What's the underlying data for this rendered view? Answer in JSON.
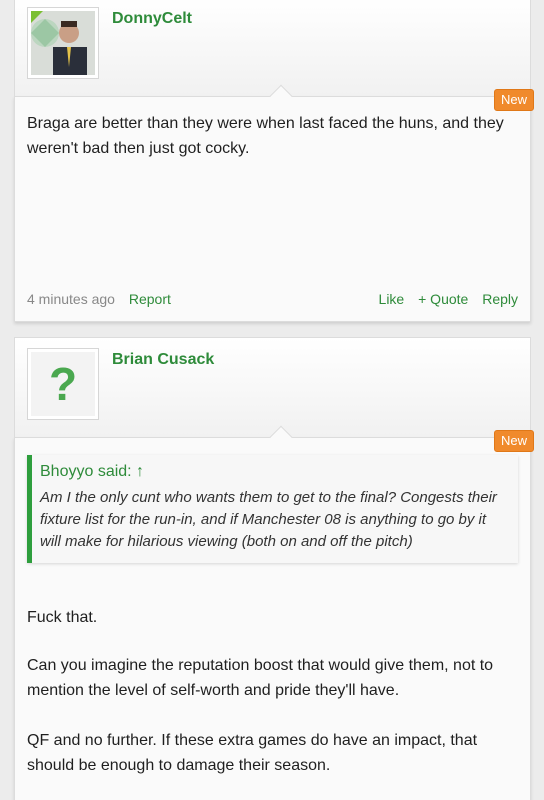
{
  "posts": [
    {
      "username": "DonnyCelt",
      "badge": "New",
      "message": "Braga are better than they were when last faced the huns, and they weren't bad then just got cocky.",
      "time": "4 minutes ago",
      "report": "Report",
      "like": "Like",
      "quote": "+ Quote",
      "reply": "Reply"
    },
    {
      "username": "Brian Cusack",
      "avatar_glyph": "?",
      "badge": "New",
      "quote_author": "Bhoyyo said: ↑",
      "quote_text": "Am I the only cunt who wants them to get to the final? Congests their fixture list for the run-in, and if Manchester 08 is anything to go by it will make for hilarious viewing (both on and off the pitch)",
      "paragraphs": [
        "Fuck that.",
        "Can you imagine the reputation boost that would give them, not to mention the level of self-worth and pride they'll have.",
        "QF and no further. If these extra games do have an impact, that should be enough to damage their season."
      ]
    }
  ],
  "colors": {
    "accent": "#2e8b3a",
    "badge": "#f08a2c",
    "quote_bar": "#2e9e3d"
  }
}
